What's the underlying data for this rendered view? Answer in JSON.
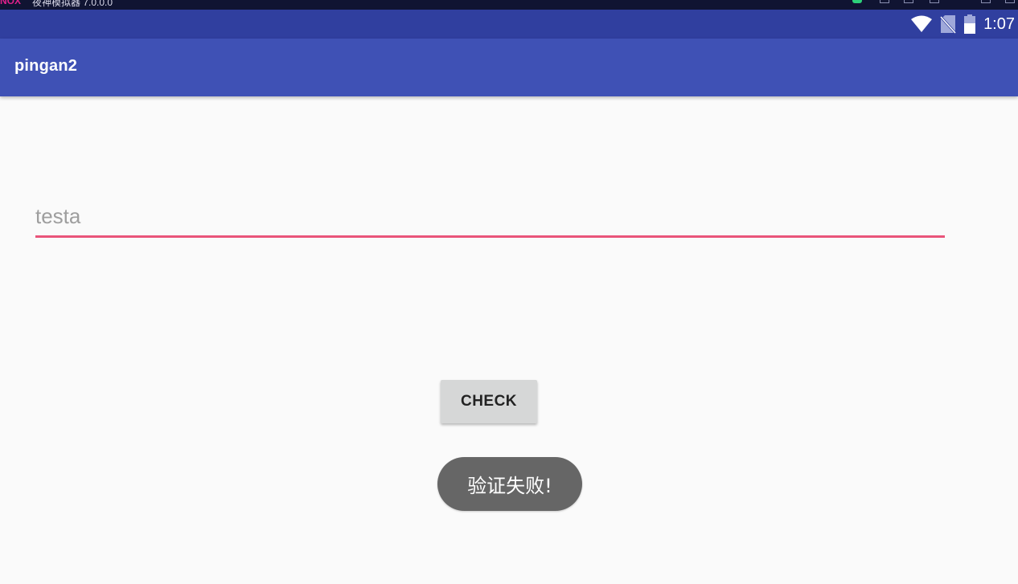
{
  "window": {
    "title": "夜神模拟器 7.0.0.0"
  },
  "status_bar": {
    "time": "1:07",
    "icons": [
      "wifi-icon",
      "no-sim-icon",
      "battery-icon"
    ]
  },
  "app_bar": {
    "title": "pingan2"
  },
  "main": {
    "input": {
      "value": "",
      "placeholder": "testa"
    },
    "check_button_label": "CHECK"
  },
  "toast": {
    "message": "验证失败!"
  },
  "colors": {
    "status_bar": "#303f9f",
    "app_bar": "#3f51b5",
    "input_underline": "#e9547a",
    "button": "#d6d7d7",
    "toast": "#666666",
    "background": "#fafafa"
  }
}
